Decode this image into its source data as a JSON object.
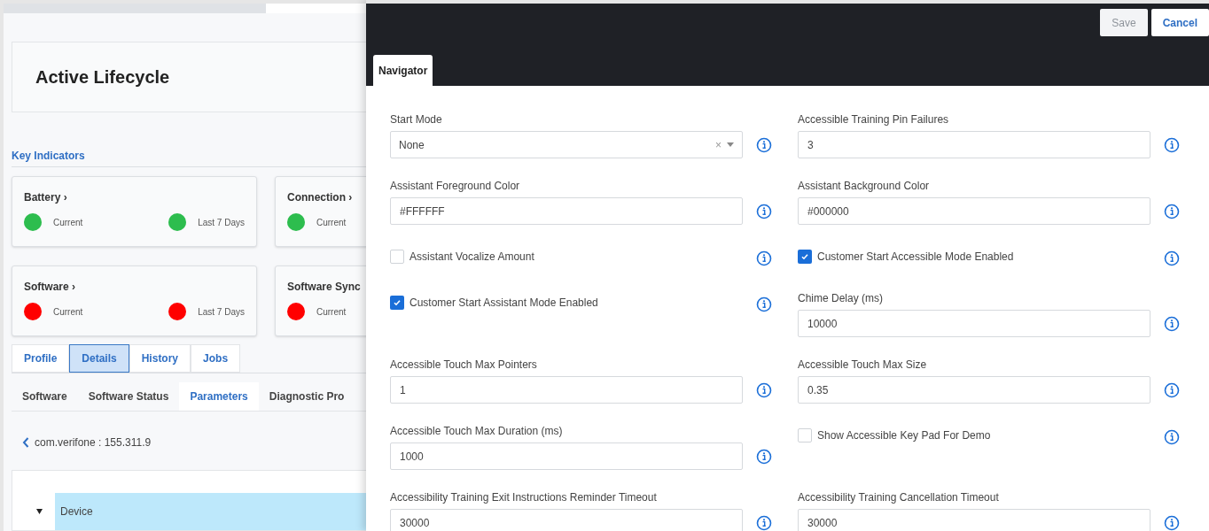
{
  "left_panel": {
    "title": "Active Lifecycle",
    "section_label": "Key Indicators",
    "indicators": [
      {
        "title": "Battery ›",
        "statuses": [
          {
            "label": "Current",
            "color": "#2dbd4e"
          },
          {
            "label": "Last 7 Days",
            "color": "#2dbd4e"
          }
        ]
      },
      {
        "title": "Connection ›",
        "statuses": [
          {
            "label": "Current",
            "color": "#2dbd4e"
          }
        ]
      },
      {
        "title": "Software ›",
        "statuses": [
          {
            "label": "Current",
            "color": "#ff0000"
          },
          {
            "label": "Last 7 Days",
            "color": "#ff0000"
          }
        ]
      },
      {
        "title": "Software Sync",
        "statuses": [
          {
            "label": "Current",
            "color": "#ff0000"
          }
        ]
      }
    ],
    "tabs": [
      {
        "label": "Profile",
        "selected": false
      },
      {
        "label": "Details",
        "selected": true
      },
      {
        "label": "History",
        "selected": false
      },
      {
        "label": "Jobs",
        "selected": false
      }
    ],
    "subtabs": [
      {
        "label": "Software",
        "selected": false
      },
      {
        "label": "Software Status",
        "selected": false
      },
      {
        "label": "Parameters",
        "selected": true
      },
      {
        "label": "Diagnostic Pro",
        "selected": false
      }
    ],
    "breadcrumb": "com.verifone : 155.311.9",
    "tree": [
      {
        "label": "Device",
        "expanded": true,
        "selected": true
      }
    ]
  },
  "drawer": {
    "buttons": [
      {
        "label": "Save",
        "disabled": true
      },
      {
        "label": "Cancel",
        "disabled": false
      }
    ],
    "tabs": [
      {
        "label": "Navigator",
        "selected": true
      }
    ],
    "rows": [
      [
        {
          "kind": "select",
          "label": "Start Mode",
          "value": "None",
          "clear": "×"
        },
        {
          "kind": "text",
          "label": "Accessible Training Pin Failures",
          "value": "3"
        }
      ],
      [
        {
          "kind": "text",
          "label": "Assistant Foreground Color",
          "value": "#FFFFFF"
        },
        {
          "kind": "text",
          "label": "Assistant Background Color",
          "value": "#000000"
        }
      ],
      [
        {
          "kind": "checkbox",
          "label": "Assistant Vocalize Amount",
          "checked": false
        },
        {
          "kind": "checkbox",
          "label": "Customer Start Accessible Mode Enabled",
          "checked": true
        }
      ],
      [
        {
          "kind": "checkbox",
          "label": "Customer Start Assistant Mode Enabled",
          "checked": true
        },
        {
          "kind": "text",
          "label": "Chime Delay (ms)",
          "value": "10000"
        }
      ],
      [
        {
          "kind": "text",
          "label": "Accessible Touch Max Pointers",
          "value": "1"
        },
        {
          "kind": "text",
          "label": "Accessible Touch Max Size",
          "value": "0.35"
        }
      ],
      [
        {
          "kind": "text",
          "label": "Accessible Touch Max Duration (ms)",
          "value": "1000"
        },
        {
          "kind": "checkbox",
          "label": "Show Accessible Key Pad For Demo",
          "checked": false
        }
      ],
      [
        {
          "kind": "text",
          "label": "Accessibility Training Exit Instructions Reminder Timeout",
          "value": "30000"
        },
        {
          "kind": "text",
          "label": "Accessibility Training Cancellation Timeout",
          "value": "30000"
        }
      ]
    ]
  }
}
